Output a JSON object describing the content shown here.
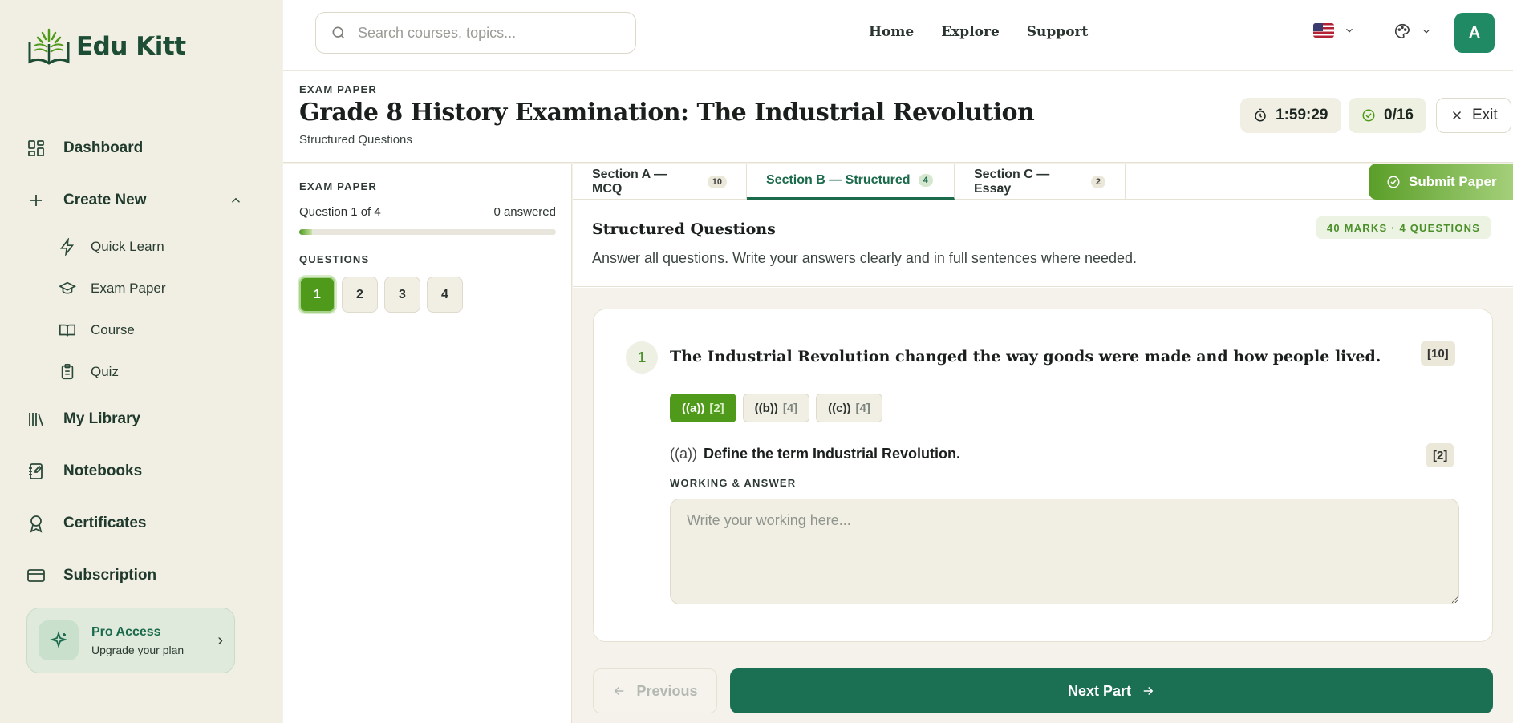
{
  "brand": {
    "name_part1": "Edu",
    "name_part2": "Kitt"
  },
  "sidebar": {
    "items": [
      {
        "label": "Dashboard",
        "icon": "dashboard-icon"
      },
      {
        "label": "Create New",
        "icon": "plus-icon"
      },
      {
        "label": "My Library",
        "icon": "library-icon"
      },
      {
        "label": "Notebooks",
        "icon": "notebook-icon"
      },
      {
        "label": "Certificates",
        "icon": "certificate-icon"
      },
      {
        "label": "Subscription",
        "icon": "credit-card-icon"
      }
    ],
    "sub_items": [
      {
        "label": "Quick Learn",
        "icon": "bolt-icon"
      },
      {
        "label": "Exam Paper",
        "icon": "graduation-cap-icon"
      },
      {
        "label": "Course",
        "icon": "book-open-icon"
      },
      {
        "label": "Quiz",
        "icon": "clipboard-icon"
      }
    ],
    "pro": {
      "title": "Pro Access",
      "subtitle": "Upgrade your plan"
    }
  },
  "topbar": {
    "search_placeholder": "Search courses, topics...",
    "nav": [
      "Home",
      "Explore",
      "Support"
    ],
    "avatar_initial": "A"
  },
  "header": {
    "eyebrow": "EXAM PAPER",
    "title": "Grade 8 History Examination: The Industrial Revolution",
    "subtitle": "Structured Questions",
    "timer": "1:59:29",
    "progress": "0/16",
    "exit_label": "Exit"
  },
  "left_panel": {
    "eyebrow": "EXAM PAPER",
    "question_of": "Question 1 of 4",
    "answered": "0 answered",
    "progress_fraction": 0.05,
    "questions_label": "QUESTIONS",
    "questions": [
      "1",
      "2",
      "3",
      "4"
    ],
    "active_question": "1"
  },
  "tabs": [
    {
      "label": "Section A — MCQ",
      "count": "10"
    },
    {
      "label": "Section B — Structured",
      "count": "4"
    },
    {
      "label": "Section C — Essay",
      "count": "2"
    }
  ],
  "submit_label": "Submit Paper",
  "section": {
    "title": "Structured Questions",
    "description": "Answer all questions. Write your answers clearly and in full sentences where needed.",
    "marks_badge": "40 MARKS · 4 QUESTIONS"
  },
  "question": {
    "number": "1",
    "text": "The Industrial Revolution changed the way goods were made and how people lived.",
    "marks": "[10]",
    "parts": [
      {
        "label": "((a))",
        "marks": "[2]"
      },
      {
        "label": "((b))",
        "marks": "[4]"
      },
      {
        "label": "((c))",
        "marks": "[4]"
      }
    ],
    "active_part_label": "((a))",
    "active_part_text": "Define the term Industrial Revolution.",
    "active_part_marks": "[2]",
    "working_label": "WORKING & ANSWER",
    "answer_placeholder": "Write your working here..."
  },
  "footer": {
    "previous": "Previous",
    "next": "Next Part"
  },
  "colors": {
    "accent_green": "#1b6f53",
    "lime": "#4f9a1a"
  }
}
